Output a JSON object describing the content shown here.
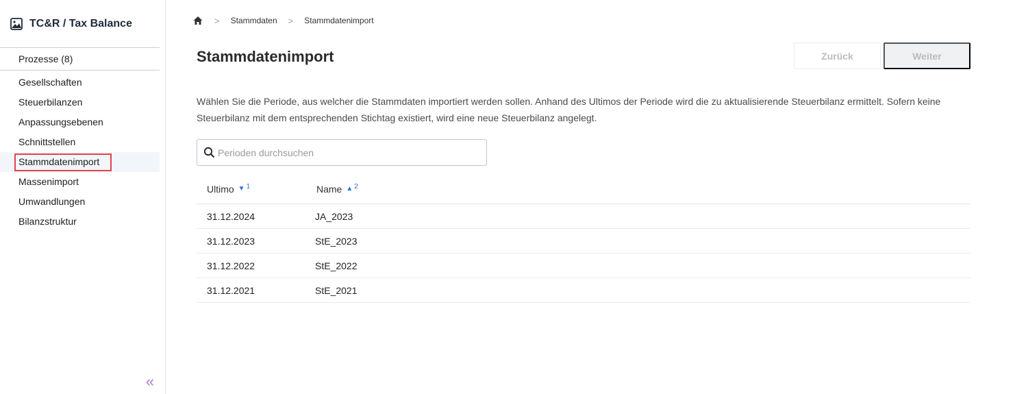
{
  "app": {
    "title": "TC&R / Tax Balance"
  },
  "sidebar": {
    "processes": "Prozesse (8)",
    "items": [
      {
        "label": "Gesellschaften"
      },
      {
        "label": "Steuerbilanzen"
      },
      {
        "label": "Anpassungsebenen"
      },
      {
        "label": "Schnittstellen"
      },
      {
        "label": "Stammdatenimport"
      },
      {
        "label": "Massenimport"
      },
      {
        "label": "Umwandlungen"
      },
      {
        "label": "Bilanzstruktur"
      }
    ],
    "active_index": 4,
    "collapse_glyph": "«"
  },
  "breadcrumb": {
    "home_icon": "home-icon",
    "items": [
      "Stammdaten",
      "Stammdatenimport"
    ]
  },
  "page": {
    "title": "Stammdatenimport",
    "back_label": "Zurück",
    "next_label": "Weiter",
    "description": "Wählen Sie die Periode, aus welcher die Stammdaten importiert werden sollen. Anhand des Ultimos der Periode wird die zu aktualisierende Steuerbilanz ermittelt. Sofern keine Steuerbilanz mit dem entsprechenden Stichtag existiert, wird eine neue Steuerbilanz angelegt."
  },
  "search": {
    "placeholder": "Perioden durchsuchen",
    "value": ""
  },
  "table": {
    "columns": [
      {
        "label": "Ultimo",
        "sort": "desc",
        "order": "1"
      },
      {
        "label": "Name",
        "sort": "asc",
        "order": "2"
      }
    ],
    "rows": [
      {
        "ultimo": "31.12.2024",
        "name": "JA_2023"
      },
      {
        "ultimo": "31.12.2023",
        "name": "StE_2023"
      },
      {
        "ultimo": "31.12.2022",
        "name": "StE_2022"
      },
      {
        "ultimo": "31.12.2021",
        "name": "StE_2021"
      }
    ]
  },
  "colors": {
    "accent": "#2f6fd6",
    "highlight": "#e2434a",
    "collapse": "#b47ad9"
  }
}
